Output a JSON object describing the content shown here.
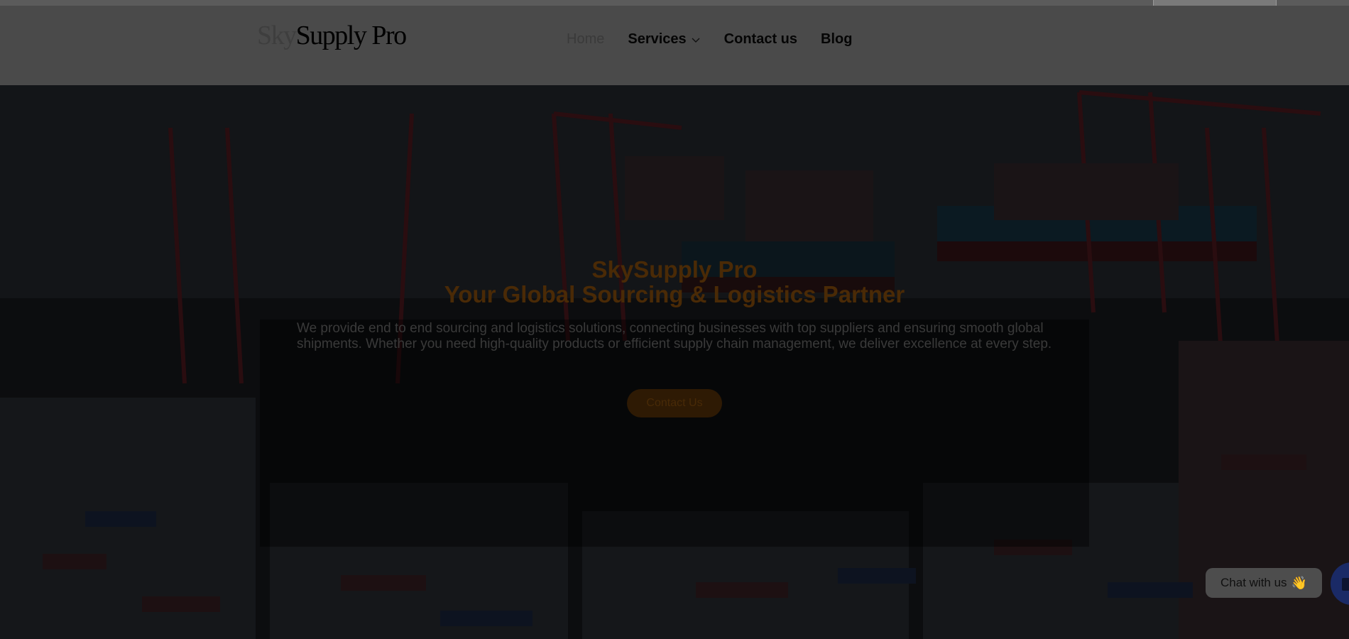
{
  "brand": {
    "logo_prefix": "Sky",
    "logo_main": "Supply Pro"
  },
  "nav": {
    "items": [
      {
        "label": "Home"
      },
      {
        "label": "Services"
      },
      {
        "label": "Contact us"
      },
      {
        "label": "Blog"
      }
    ]
  },
  "hero": {
    "title_line1": "SkySupply Pro",
    "title_line2": "Your Global Sourcing & Logistics Partner",
    "description": "We provide end to end sourcing and logistics solutions, connecting businesses with top suppliers and ensuring smooth global shipments. Whether you need high-quality products or efficient supply chain management, we deliver excellence at every step.",
    "cta_label": "Contact Us"
  },
  "chat": {
    "label": "Chat with us",
    "emoji": "👋"
  },
  "colors": {
    "accent": "#f59e0b",
    "overlay": "#000000"
  }
}
